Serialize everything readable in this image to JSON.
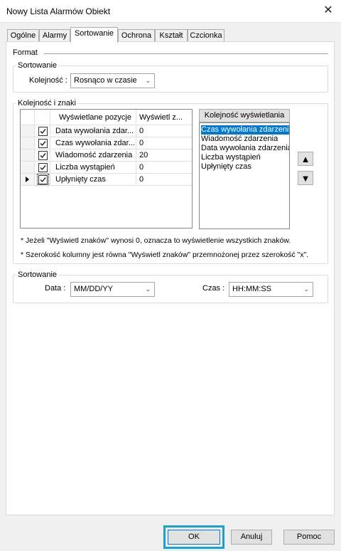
{
  "window": {
    "title": "Nowy Lista Alarmów Obiekt",
    "close_glyph": "✕"
  },
  "tabs": [
    {
      "label": "Ogólne"
    },
    {
      "label": "Alarmy"
    },
    {
      "label": "Sortowanie",
      "active": true
    },
    {
      "label": "Ochrona"
    },
    {
      "label": "Kształt"
    },
    {
      "label": "Czcionka"
    }
  ],
  "format_label": "Format",
  "sort_group": {
    "legend": "Sortowanie",
    "order_label": "Kolejność :",
    "order_value": "Rosnąco w czasie"
  },
  "order_group": {
    "legend": "Kolejność i znaki",
    "grid": {
      "col_position": "Wyświetlane pozycje",
      "col_chars": "Wyświetl z...",
      "rows": [
        {
          "label": "Data wywołania zdar...",
          "chars": "0",
          "checked": true
        },
        {
          "label": "Czas wywołania zdar...",
          "chars": "0",
          "checked": true
        },
        {
          "label": "Wiadomość zdarzenia",
          "chars": "20",
          "checked": true
        },
        {
          "label": "Liczba wystąpień",
          "chars": "0",
          "checked": true
        },
        {
          "label": "Upłynięty czas",
          "chars": "0",
          "checked": true,
          "current": true
        }
      ]
    },
    "display_order_button": "Kolejność wyświetlania",
    "display_list": [
      {
        "label": "Czas wywołania zdarzenia",
        "selected": true
      },
      {
        "label": "Wiadomość zdarzenia"
      },
      {
        "label": "Data wywołania zdarzenia"
      },
      {
        "label": "Liczba wystąpień"
      },
      {
        "label": "Upłynięty czas"
      }
    ],
    "move_up_glyph": "▲",
    "move_down_glyph": "▼",
    "note1": "* Jeżeli \"Wyświetl znaków\" wynosi 0, oznacza to wyświetlenie wszystkich znaków.",
    "note2": "* Szerokość kolumny jest równa \"Wyświetl znaków\" przemnożonej przez szerokość \"x\"."
  },
  "sort_format_group": {
    "legend": "Sortowanie",
    "date_label": "Data :",
    "date_value": "MM/DD/YY",
    "time_label": "Czas :",
    "time_value": "HH:MM:SS"
  },
  "footer": {
    "ok": "OK",
    "cancel": "Anuluj",
    "help": "Pomoc"
  },
  "colors": {
    "selection": "#0078d7",
    "ok_highlight": "#1aa0d8"
  }
}
